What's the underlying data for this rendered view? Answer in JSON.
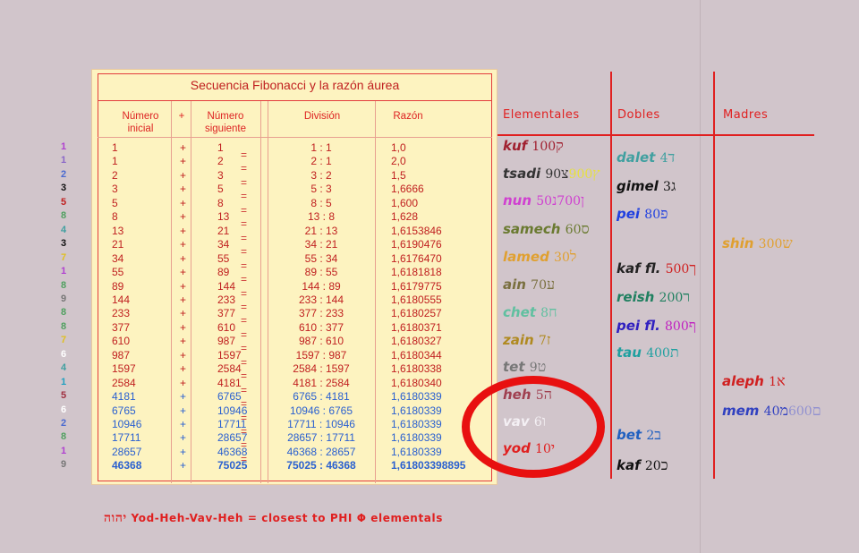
{
  "table": {
    "title": "Secuencia Fibonacci y la razón áurea",
    "headers": {
      "numero_inicial": "Número\ninicial",
      "plus": "+",
      "numero_siguiente": "Número\nsiguiente",
      "division": "División",
      "razon": "Razón"
    },
    "rows": [
      {
        "a": "1",
        "plus": "+",
        "b": "1",
        "div": "1 : 1",
        "ratio": "1,0",
        "digit": "1",
        "digit_color": "#b040d0"
      },
      {
        "a": "1",
        "plus": "+",
        "b": "2",
        "div": "2 : 1",
        "ratio": "2,0",
        "digit": "1",
        "digit_color": "#8a66c8"
      },
      {
        "a": "2",
        "plus": "+",
        "b": "3",
        "div": "3 : 2",
        "ratio": "1,5",
        "digit": "2",
        "digit_color": "#4a6ad0"
      },
      {
        "a": "3",
        "plus": "+",
        "b": "5",
        "div": "5 : 3",
        "ratio": "1,6666",
        "digit": "3",
        "digit_color": "#111111"
      },
      {
        "a": "5",
        "plus": "+",
        "b": "8",
        "div": "8 : 5",
        "ratio": "1,600",
        "digit": "5",
        "digit_color": "#c02020"
      },
      {
        "a": "8",
        "plus": "+",
        "b": "13",
        "div": "13 : 8",
        "ratio": "1,628",
        "digit": "8",
        "digit_color": "#50a060"
      },
      {
        "a": "13",
        "plus": "+",
        "b": "21",
        "div": "21 : 13",
        "ratio": "1,6153846",
        "digit": "4",
        "digit_color": "#40a0a0"
      },
      {
        "a": "21",
        "plus": "+",
        "b": "34",
        "div": "34 : 21",
        "ratio": "1,6190476",
        "digit": "3",
        "digit_color": "#111111"
      },
      {
        "a": "34",
        "plus": "+",
        "b": "55",
        "div": "55 : 34",
        "ratio": "1,6176470",
        "digit": "7",
        "digit_color": "#e0c020"
      },
      {
        "a": "55",
        "plus": "+",
        "b": "89",
        "div": "89 : 55",
        "ratio": "1,6181818",
        "digit": "1",
        "digit_color": "#b040d0"
      },
      {
        "a": "89",
        "plus": "+",
        "b": "144",
        "div": "144 : 89",
        "ratio": "1,6179775",
        "digit": "8",
        "digit_color": "#50a060"
      },
      {
        "a": "144",
        "plus": "+",
        "b": "233",
        "div": "233 : 144",
        "ratio": "1,6180555",
        "digit": "9",
        "digit_color": "#777777"
      },
      {
        "a": "233",
        "plus": "+",
        "b": "377",
        "div": "377 : 233",
        "ratio": "1,6180257",
        "digit": "8",
        "digit_color": "#50a060"
      },
      {
        "a": "377",
        "plus": "+",
        "b": "610",
        "div": "610 : 377",
        "ratio": "1,6180371",
        "digit": "8",
        "digit_color": "#50a060"
      },
      {
        "a": "610",
        "plus": "+",
        "b": "987",
        "div": "987 : 610",
        "ratio": "1,6180327",
        "digit": "7",
        "digit_color": "#e0c020"
      },
      {
        "a": "987",
        "plus": "+",
        "b": "1597",
        "div": "1597 : 987",
        "ratio": "1,6180344",
        "digit": "6",
        "digit_color": "#ffffff"
      },
      {
        "a": "1597",
        "plus": "+",
        "b": "2584",
        "div": "2584 : 1597",
        "ratio": "1,6180338",
        "digit": "4",
        "digit_color": "#40a0a0"
      },
      {
        "a": "2584",
        "plus": "+",
        "b": "4181",
        "div": "4181 : 2584",
        "ratio": "1,6180340",
        "digit": "1",
        "digit_color": "#20a0c0"
      },
      {
        "a": "4181",
        "plus": "+",
        "b": "6765",
        "div": "6765 : 4181",
        "ratio": "1,6180339",
        "digit": "5",
        "digit_color": "#a03040"
      },
      {
        "a": "6765",
        "plus": "+",
        "b": "10946",
        "div": "10946 : 6765",
        "ratio": "1,6180339",
        "digit": "6",
        "digit_color": "#ffffff"
      },
      {
        "a": "10946",
        "plus": "+",
        "b": "17711",
        "div": "17711 : 10946",
        "ratio": "1,6180339",
        "digit": "2",
        "digit_color": "#4a6ad0"
      },
      {
        "a": "17711",
        "plus": "+",
        "b": "28657",
        "div": "28657 : 17711",
        "ratio": "1,6180339",
        "digit": "8",
        "digit_color": "#50a060"
      },
      {
        "a": "28657",
        "plus": "+",
        "b": "46368",
        "div": "46368 : 28657",
        "ratio": "1,6180339",
        "digit": "1",
        "digit_color": "#b040d0"
      },
      {
        "a": "46368",
        "plus": "+",
        "b": "75025",
        "div": "75025 : 46368",
        "ratio": "1,61803398895",
        "digit": "9",
        "digit_color": "#777777"
      }
    ],
    "equals": [
      "=",
      "=",
      "=",
      "=",
      "=",
      "=",
      "=",
      "=",
      "=",
      "=",
      "=",
      "=",
      "=",
      "=",
      "=",
      "=",
      "=",
      "=",
      "=",
      "=",
      "=",
      "=",
      "="
    ]
  },
  "columns": {
    "elementales": "Elementales",
    "dobles": "Dobles",
    "madres": "Madres"
  },
  "elementales": [
    {
      "name": "kuf",
      "heb": "ק",
      "num": "100",
      "color": "#a02030"
    },
    {
      "name": "tsadi",
      "heb": "ץ",
      "num2": "900",
      "heb2": "צ",
      "num": "90",
      "color": "#333333",
      "heb_color": "#e6e040"
    },
    {
      "name": "nun",
      "heb": "ן",
      "num2": "700",
      "heb2": "נ",
      "num": "50",
      "color": "#d040d0"
    },
    {
      "name": "samech",
      "heb": "ס",
      "num": "60",
      "color": "#6a7a30"
    },
    {
      "name": "lamed",
      "heb": "ל",
      "num": "30",
      "color": "#e0a030"
    },
    {
      "name": "ain",
      "heb": "ע",
      "num": "70",
      "color": "#7a7040"
    },
    {
      "name": "chet",
      "heb": "ח",
      "num": "8",
      "color": "#60c0a0"
    },
    {
      "name": "zain",
      "heb": "ז",
      "num": "7",
      "color": "#b08a20"
    },
    {
      "name": "tet",
      "heb": "ט",
      "num": "9",
      "color": "#777777"
    },
    {
      "name": "heh",
      "heb": "ה",
      "num": "5",
      "color": "#a04050"
    },
    {
      "name": "vav",
      "heb": "ו",
      "num": "6",
      "color": "#f4f0f4"
    },
    {
      "name": "yod",
      "heb": "י",
      "num": "10",
      "color": "#e02020"
    }
  ],
  "dobles": [
    {
      "name": "dalet",
      "heb": "ד",
      "num": "4",
      "color": "#40a0a0"
    },
    {
      "name": "gimel",
      "heb": "ג",
      "num": "3",
      "color": "#111111"
    },
    {
      "name": "pei",
      "heb": "פ",
      "num": "80",
      "color": "#2040e0"
    },
    {
      "name": "kaf fl.",
      "heb": "ך",
      "num": "500",
      "color": "#222222",
      "heb_color": "#d02020"
    },
    {
      "name": "reish",
      "heb": "ר",
      "num": "200",
      "color": "#208060"
    },
    {
      "name": "pei fl.",
      "heb": "ף",
      "num": "800",
      "color": "#3020c0",
      "heb_color": "#c020c0"
    },
    {
      "name": "tau",
      "heb": "ת",
      "num": "400",
      "color": "#20a0a0"
    },
    {
      "name": "bet",
      "heb": "ב",
      "num": "2",
      "color": "#2060c0"
    },
    {
      "name": "kaf",
      "heb": "כ",
      "num": "20",
      "color": "#111111"
    }
  ],
  "madres": [
    {
      "name": "shin",
      "heb": "ש",
      "num": "300",
      "color": "#e0a030"
    },
    {
      "name": "aleph",
      "heb": "א",
      "num": "1",
      "color": "#d02020"
    },
    {
      "name": "mem",
      "heb": "ם",
      "num2": "600",
      "heb2": "מ",
      "num": "40",
      "color": "#3040c0",
      "heb_color": "#9090d0"
    }
  ],
  "caption": {
    "heb": "יהוה",
    "text": "Yod-Heh-Vav-Heh = closest to PHI Φ elementals"
  },
  "colors": {
    "background": "#d1c5cb",
    "card": "#fdf3c0",
    "accent_red": "#e02020",
    "ratio_blue": "#2a60d0"
  }
}
